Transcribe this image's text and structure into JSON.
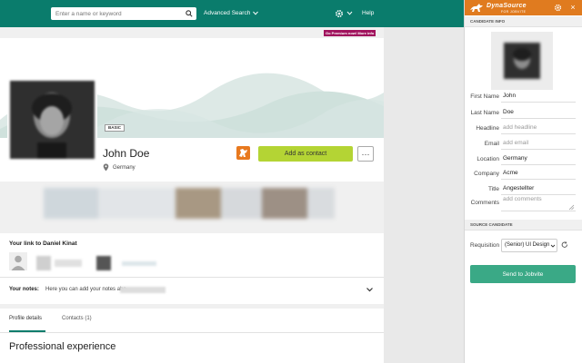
{
  "topbar": {
    "search_placeholder": "Enter a name or keyword",
    "advanced_search": "Advanced Search",
    "help": "Help"
  },
  "premium_badge": "Go Premium now! More info",
  "profile": {
    "badge": "BASIC",
    "name": "John Doe",
    "location": "Germany",
    "add_contact": "Add as contact",
    "more": "···"
  },
  "link_section": {
    "title": "Your link to Daniel Kinat",
    "notes_label": "Your notes:",
    "notes_text": "Here you can add your notes abo"
  },
  "tabs": [
    {
      "label": "Profile details"
    },
    {
      "label": "Contacts (1)"
    }
  ],
  "professional_experience": "Professional experience",
  "panel": {
    "logo": "DynaSource",
    "logo_sub": "FOR JOBVITE",
    "candidate_info_header": "CANDIDATE INFO",
    "fields": {
      "first_name": {
        "label": "First Name",
        "value": "John"
      },
      "last_name": {
        "label": "Last Name",
        "value": "Doe"
      },
      "headline": {
        "label": "Headline",
        "placeholder": "add headline"
      },
      "email": {
        "label": "Email",
        "placeholder": "add email"
      },
      "location": {
        "label": "Location",
        "value": "Germany"
      },
      "company": {
        "label": "Company",
        "value": "Acme"
      },
      "title": {
        "label": "Title",
        "value": "Angestellter"
      },
      "comments": {
        "label": "Comments",
        "placeholder": "add comments"
      }
    },
    "source_candidate_header": "SOURCE CANDIDATE",
    "requisition_label": "Requisition",
    "requisition_value": "(Senior) UI Design",
    "send_button": "Send to Jobvite"
  },
  "colors": {
    "brand_teal": "#0a7c6c",
    "dynasource_orange": "#e07b1f",
    "add_contact_green": "#b4d434",
    "send_button_green": "#3aa986",
    "premium_magenta": "#a0125d"
  },
  "icons": [
    "search-icon",
    "gear-icon",
    "chevron-down-icon",
    "location-pin-icon",
    "dinosaur-logo-icon",
    "person-icon",
    "refresh-icon",
    "close-icon"
  ]
}
